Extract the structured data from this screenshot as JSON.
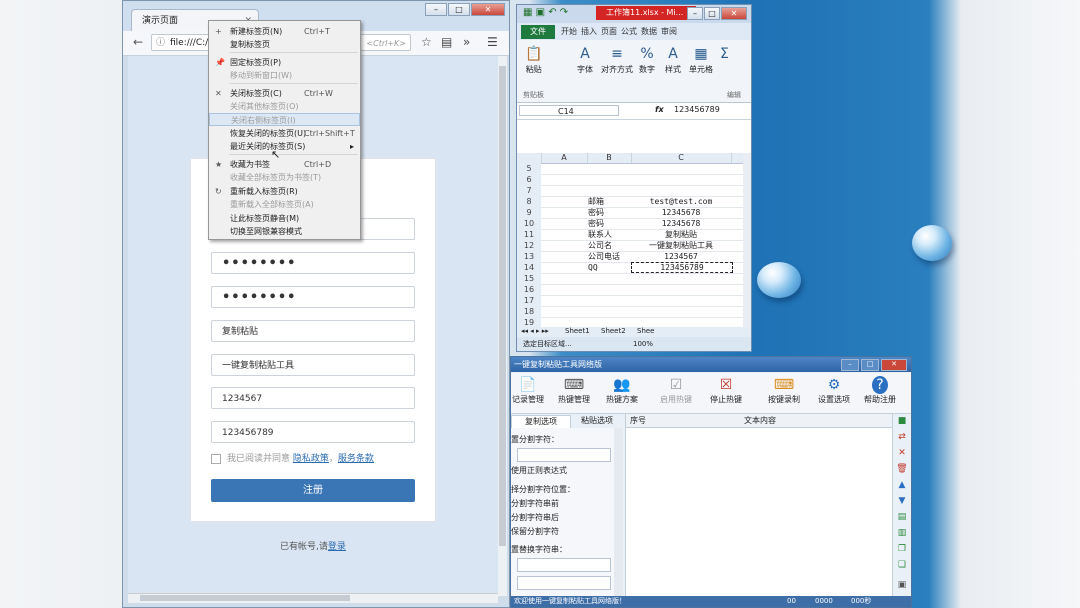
{
  "browser": {
    "tab_title": "演示页面",
    "url": "file:///C:/U",
    "url_hint": "<Ctrl+K>",
    "form": {
      "fields": [
        "",
        "••••••••",
        "••••••••",
        "复制粘贴",
        "一键复制粘贴工具",
        "1234567",
        "123456789"
      ],
      "agree_text": "我已阅读并同意",
      "agree_links": [
        "隐私政策",
        "服务条款"
      ],
      "register_label": "注册",
      "login_prefix": "已有帐号,请",
      "login_link": "登录"
    },
    "context_menu": [
      {
        "label": "新建标签页(N)",
        "shortcut": "Ctrl+T",
        "icon": "+",
        "disabled": false
      },
      {
        "label": "复制标签页",
        "shortcut": "",
        "icon": "",
        "disabled": false
      },
      {
        "label": "固定标签页(P)",
        "shortcut": "",
        "icon": "pin",
        "disabled": false
      },
      {
        "label": "移动到新窗口(W)",
        "shortcut": "",
        "icon": "",
        "disabled": true
      },
      {
        "label": "关闭标签页(C)",
        "shortcut": "Ctrl+W",
        "icon": "×",
        "disabled": false
      },
      {
        "label": "关闭其他标签页(O)",
        "shortcut": "",
        "icon": "",
        "disabled": true
      },
      {
        "label": "关闭右侧标签页(I)",
        "shortcut": "",
        "icon": "",
        "disabled": true
      },
      {
        "label": "恢复关闭的标签页(U)",
        "shortcut": "Ctrl+Shift+T",
        "icon": "",
        "disabled": false
      },
      {
        "label": "最近关闭的标签页(S)",
        "shortcut": "",
        "icon": "",
        "disabled": false,
        "submenu": true
      },
      {
        "label": "收藏为书签",
        "shortcut": "Ctrl+D",
        "icon": "star",
        "disabled": false
      },
      {
        "label": "收藏全部标签页为书签(T)",
        "shortcut": "",
        "icon": "",
        "disabled": true
      },
      {
        "label": "重新载入标签页(R)",
        "shortcut": "",
        "icon": "reload",
        "disabled": false
      },
      {
        "label": "重新载入全部标签页(A)",
        "shortcut": "",
        "icon": "",
        "disabled": true
      },
      {
        "label": "让此标签页静音(M)",
        "shortcut": "",
        "icon": "",
        "disabled": false
      },
      {
        "label": "切换至网银兼容模式",
        "shortcut": "",
        "icon": "",
        "disabled": false
      }
    ]
  },
  "excel": {
    "doc_title": "工作簿11.xlsx - Mi...",
    "file_tab": "文件",
    "ribbon_tabs": [
      "开始",
      "插入",
      "页面",
      "公式",
      "数据",
      "审阅"
    ],
    "ribbon_buttons": [
      "粘贴",
      "字体",
      "对齐方式",
      "数字",
      "样式",
      "单元格",
      "编辑"
    ],
    "clipboard_group": "剪贴板",
    "name_box": "C14",
    "formula_value": "123456789",
    "columns": [
      "A",
      "B",
      "C"
    ],
    "rows": [
      {
        "n": "5",
        "b": "",
        "c": ""
      },
      {
        "n": "6",
        "b": "",
        "c": ""
      },
      {
        "n": "7",
        "b": "",
        "c": ""
      },
      {
        "n": "8",
        "b": "邮箱",
        "c": "test@test.com"
      },
      {
        "n": "9",
        "b": "密码",
        "c": "12345678"
      },
      {
        "n": "10",
        "b": "密码",
        "c": "12345678"
      },
      {
        "n": "11",
        "b": "联系人",
        "c": "复制粘贴"
      },
      {
        "n": "12",
        "b": "公司名",
        "c": "一键复制粘贴工具"
      },
      {
        "n": "13",
        "b": "公司电话",
        "c": "1234567"
      },
      {
        "n": "14",
        "b": "QQ",
        "c": "123456789"
      },
      {
        "n": "15",
        "b": "",
        "c": ""
      },
      {
        "n": "16",
        "b": "",
        "c": ""
      },
      {
        "n": "17",
        "b": "",
        "c": ""
      },
      {
        "n": "18",
        "b": "",
        "c": ""
      },
      {
        "n": "19",
        "b": "",
        "c": ""
      }
    ],
    "sheets": [
      "Sheet1",
      "Sheet2",
      "Shee"
    ],
    "status_text": "选定目标区域...",
    "zoom": "100%"
  },
  "tool": {
    "title": "一键复制粘贴工具网络版",
    "buttons": [
      {
        "label": "记录管理",
        "icon": "doc"
      },
      {
        "label": "热键管理",
        "icon": "hotkey"
      },
      {
        "label": "热键方案",
        "icon": "people"
      },
      {
        "label": "启用热键",
        "icon": "check",
        "disabled": true
      },
      {
        "label": "停止热键",
        "icon": "stop"
      },
      {
        "label": "按键录制",
        "icon": "keyboard"
      },
      {
        "label": "设置选项",
        "icon": "gear"
      },
      {
        "label": "帮助注册",
        "icon": "help"
      }
    ],
    "tabs": [
      "复制选项",
      "粘贴选项"
    ],
    "left_labels": [
      "置分割字符：",
      "使用正则表达式",
      "择分割字符位置：",
      "分割字符串前",
      "分割字符串后",
      "保留分割字符",
      "置替换字符串："
    ],
    "list_headers": [
      "序号",
      "文本内容"
    ],
    "status_text": "欢迎使用一键复制粘贴工具网络版！",
    "status_values": [
      "00",
      "0000",
      "000秒"
    ]
  }
}
